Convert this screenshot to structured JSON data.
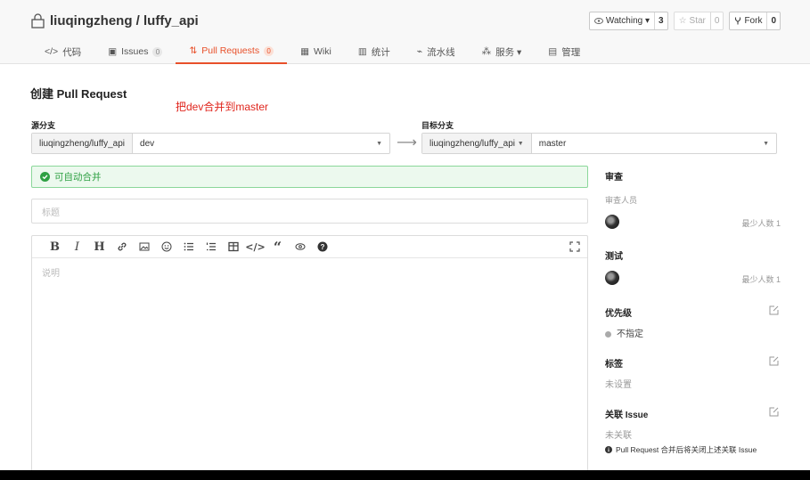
{
  "repo": {
    "owner": "liuqingzheng",
    "separator": "/",
    "name": "luffy_api"
  },
  "actions": [
    {
      "label": "Watching ▾",
      "count": "3",
      "icon": "eye-icon",
      "dim": false
    },
    {
      "label": "Star",
      "count": "0",
      "icon": "star-icon",
      "dim": true
    },
    {
      "label": "Fork",
      "count": "0",
      "icon": "fork-icon",
      "dim": false
    }
  ],
  "tabs": [
    {
      "label": "代码",
      "icon": "code-icon"
    },
    {
      "label": "Issues",
      "badge": "0",
      "icon": "issue-icon"
    },
    {
      "label": "Pull Requests",
      "badge": "0",
      "icon": "pull-request-icon",
      "active": true
    },
    {
      "label": "Wiki",
      "icon": "wiki-icon"
    },
    {
      "label": "统计",
      "icon": "chart-icon"
    },
    {
      "label": "流水线",
      "icon": "pipeline-icon"
    },
    {
      "label": "服务 ▾",
      "icon": "service-icon"
    },
    {
      "label": "管理",
      "icon": "manage-icon"
    }
  ],
  "page": {
    "heading": "创建 Pull Request",
    "annotation": "把dev合并到master",
    "source_label": "源分支",
    "target_label": "目标分支",
    "source_repo": "liuqingzheng/luffy_api",
    "source_branch": "dev",
    "target_repo": "liuqingzheng/luffy_api",
    "target_branch": "master",
    "merge_status": "可自动合并",
    "title_placeholder": "标题",
    "body_placeholder": "说明"
  },
  "sidebar": {
    "review_title": "审查",
    "reviewers_label": "审查人员",
    "reviewers_min": "最少人数 1",
    "test_title": "测试",
    "testers_min": "最少人数 1",
    "priority_title": "优先级",
    "priority_value": "不指定",
    "labels_title": "标签",
    "labels_value": "未设置",
    "issue_title": "关联 Issue",
    "issue_value": "未关联",
    "issue_note": "Pull Request 合并后将关闭上述关联 Issue"
  },
  "colors": {
    "accent": "#e8502a",
    "success": "#2ea043",
    "annotation": "#e0261e"
  }
}
